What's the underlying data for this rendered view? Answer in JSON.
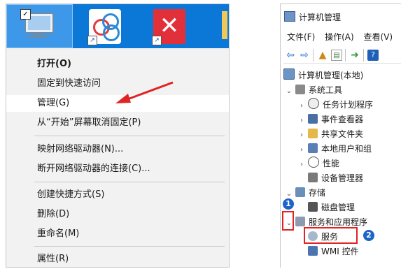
{
  "left": {
    "menu": {
      "open": "打开(O)",
      "pin_quick": "固定到快速访问",
      "manage": "管理(G)",
      "unpin_start": "从“开始”屏幕取消固定(P)",
      "map_drive": "映射网络驱动器(N)...",
      "disconnect_drive": "断开网络驱动器的连接(C)...",
      "create_shortcut": "创建快捷方式(S)",
      "delete": "删除(D)",
      "rename": "重命名(M)",
      "properties": "属性(R)"
    },
    "colors": {
      "taskbar": "#0b77d6",
      "arrow": "#e02424"
    }
  },
  "right": {
    "title": "计算机管理",
    "menubar": [
      "文件(F)",
      "操作(A)",
      "查看(V)"
    ],
    "tree": {
      "root": "计算机管理(本地)",
      "system_tools": "系统工具",
      "task_scheduler": "任务计划程序",
      "event_viewer": "事件查看器",
      "shared_folders": "共享文件夹",
      "local_users": "本地用户和组",
      "performance": "性能",
      "device_manager": "设备管理器",
      "storage": "存储",
      "disk_mgmt": "磁盘管理",
      "services_apps": "服务和应用程序",
      "services": "服务",
      "wmi": "WMI 控件"
    },
    "badges": {
      "one": "1",
      "two": "2"
    }
  }
}
